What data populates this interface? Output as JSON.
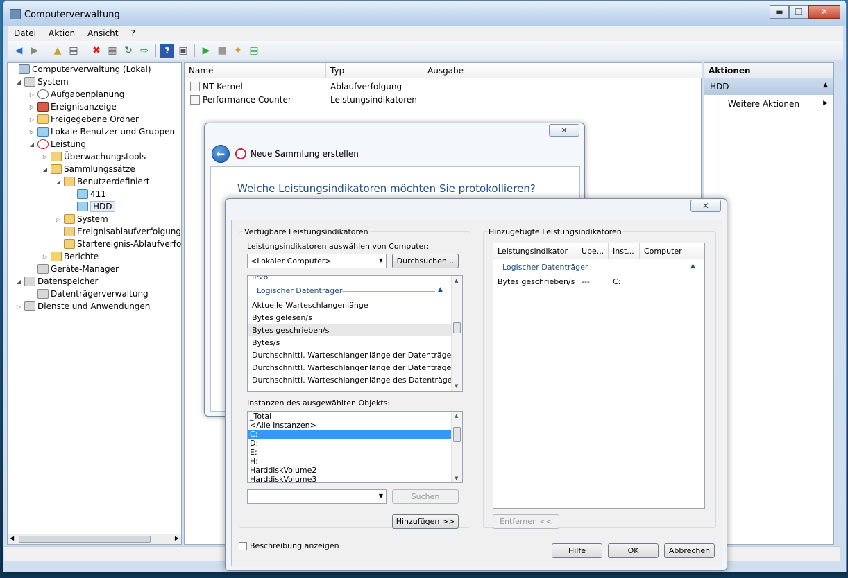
{
  "window": {
    "title": "Computerverwaltung"
  },
  "menu": [
    "Datei",
    "Aktion",
    "Ansicht",
    "?"
  ],
  "tree": {
    "items": [
      {
        "label": "Computerverwaltung (Lokal)"
      },
      {
        "label": "System"
      },
      {
        "label": "Aufgabenplanung"
      },
      {
        "label": "Ereignisanzeige"
      },
      {
        "label": "Freigegebene Ordner"
      },
      {
        "label": "Lokale Benutzer und Gruppen"
      },
      {
        "label": "Leistung"
      },
      {
        "label": "Überwachungstools"
      },
      {
        "label": "Sammlungssätze"
      },
      {
        "label": "Benutzerdefiniert"
      },
      {
        "label": "411"
      },
      {
        "label": "HDD"
      },
      {
        "label": "System"
      },
      {
        "label": "Ereignisablaufverfolgungssit"
      },
      {
        "label": "Startereignis-Ablaufverfolgu"
      },
      {
        "label": "Berichte"
      },
      {
        "label": "Geräte-Manager"
      },
      {
        "label": "Datenspeicher"
      },
      {
        "label": "Datenträgerverwaltung"
      },
      {
        "label": "Dienste und Anwendungen"
      }
    ]
  },
  "main": {
    "columns": [
      "Name",
      "Typ",
      "Ausgabe"
    ],
    "rows": [
      {
        "name": "NT Kernel",
        "type": "Ablaufverfolgung"
      },
      {
        "name": "Performance Counter",
        "type": "Leistungsindikatoren"
      }
    ]
  },
  "actions": {
    "header": "Aktionen",
    "section": "HDD",
    "item": "Weitere Aktionen"
  },
  "wizard": {
    "title": "Neue Sammlung erstellen",
    "question": "Welche Leistungsindikatoren möchten Sie protokollieren?"
  },
  "counters_dialog": {
    "available_group": "Verfügbare Leistungsindikatoren",
    "select_from_label": "Leistungsindikatoren auswählen von Computer:",
    "computer_value": "<Lokaler Computer>",
    "browse_button": "Durchsuchen...",
    "counter_partial_top": "IPv6",
    "category": "Logischer Datenträger",
    "counters": [
      "Aktuelle Warteschlangenlänge",
      "Bytes gelesen/s",
      "Bytes geschrieben/s",
      "Bytes/s",
      "Durchschnittl. Warteschlangenlänge der Datenträger-Le...",
      "Durchschnittl. Warteschlangenlänge der Datenträger-Sc...",
      "Durchschnittl. Warteschlangenlänge des Datenträgers"
    ],
    "selected_counter_index": 2,
    "instances_label": "Instanzen des ausgewählten Objekts:",
    "instances": [
      "_Total",
      "<Alle Instanzen>",
      "C:",
      "D:",
      "E:",
      "H:",
      "HarddiskVolume2",
      "HarddiskVolume3"
    ],
    "selected_instance": "C:",
    "search_button": "Suchen",
    "add_button": "Hinzufügen >>",
    "added_group": "Hinzugefügte Leistungsindikatoren",
    "added_columns": [
      "Leistungsindikator",
      "Übe...",
      "Inst...",
      "Computer"
    ],
    "added_category": "Logischer Datenträger",
    "added_row": {
      "counter": "Bytes geschrieben/s",
      "parent": "---",
      "instance": "C:"
    },
    "remove_button": "Entfernen <<",
    "show_description": "Beschreibung anzeigen",
    "help_button": "Hilfe",
    "ok_button": "OK",
    "cancel_button": "Abbrechen"
  }
}
